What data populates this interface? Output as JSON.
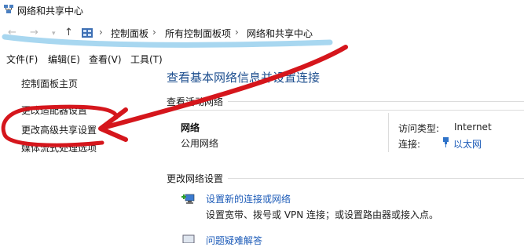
{
  "window": {
    "title": "网络和共享中心"
  },
  "breadcrumb": [
    "控制面板",
    "所有控制面板项",
    "网络和共享中心"
  ],
  "menu": [
    "文件(F)",
    "编辑(E)",
    "查看(V)",
    "工具(T)"
  ],
  "sidebar": {
    "items": [
      "控制面板主页",
      "更改适配器设置",
      "更改高级共享设置",
      "媒体流式处理选项"
    ]
  },
  "main": {
    "title": "查看基本网络信息并设置连接",
    "active_networks_header": "查看活动网络",
    "network": {
      "name": "网络",
      "category": "公用网络",
      "access_type_label": "访问类型:",
      "access_type_value": "Internet",
      "connection_label": "连接:",
      "connection_value": "以太网"
    },
    "change_settings_header": "更改网络设置",
    "actions": [
      {
        "title": "设置新的连接或网络",
        "desc": "设置宽带、拨号或 VPN 连接；或设置路由器或接入点。"
      },
      {
        "title": "问题疑难解答",
        "desc": ""
      }
    ]
  },
  "colors": {
    "link": "#1c5bb8",
    "title": "#1e4f8f",
    "annotation_red": "#d5161c",
    "annotation_blue": "#9fd3ee"
  }
}
